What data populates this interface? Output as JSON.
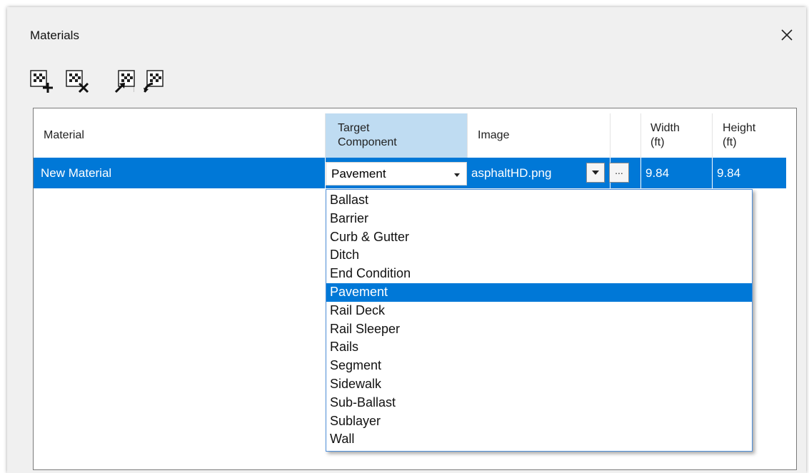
{
  "window": {
    "title": "Materials"
  },
  "grid": {
    "columns": [
      {
        "label": "Material"
      },
      {
        "label": "Target Component",
        "selected": true
      },
      {
        "label": "Image"
      },
      {
        "label": ""
      },
      {
        "label": "Width (ft)"
      },
      {
        "label": "Height (ft)"
      }
    ],
    "rows": [
      {
        "material": "New Material",
        "target_component": "Pavement",
        "image": "asphaltHD.png",
        "browse_label": "...",
        "width": "9.84",
        "height": "9.84"
      }
    ]
  },
  "dropdown": {
    "options": [
      "Ballast",
      "Barrier",
      "Curb & Gutter",
      "Ditch",
      "End Condition",
      "Pavement",
      "Rail Deck",
      "Rail Sleeper",
      "Rails",
      "Segment",
      "Sidewalk",
      "Sub-Ballast",
      "Sublayer",
      "Wall"
    ],
    "selected": "Pavement"
  },
  "colors": {
    "selection": "#0078d7",
    "header_selected": "#bfdcf2",
    "dropdown_border": "#4f8fd9"
  },
  "icons": [
    "add-material-icon",
    "delete-material-icon",
    "import-material-icon",
    "export-material-icon",
    "close-icon",
    "dropdown-arrow-icon"
  ]
}
